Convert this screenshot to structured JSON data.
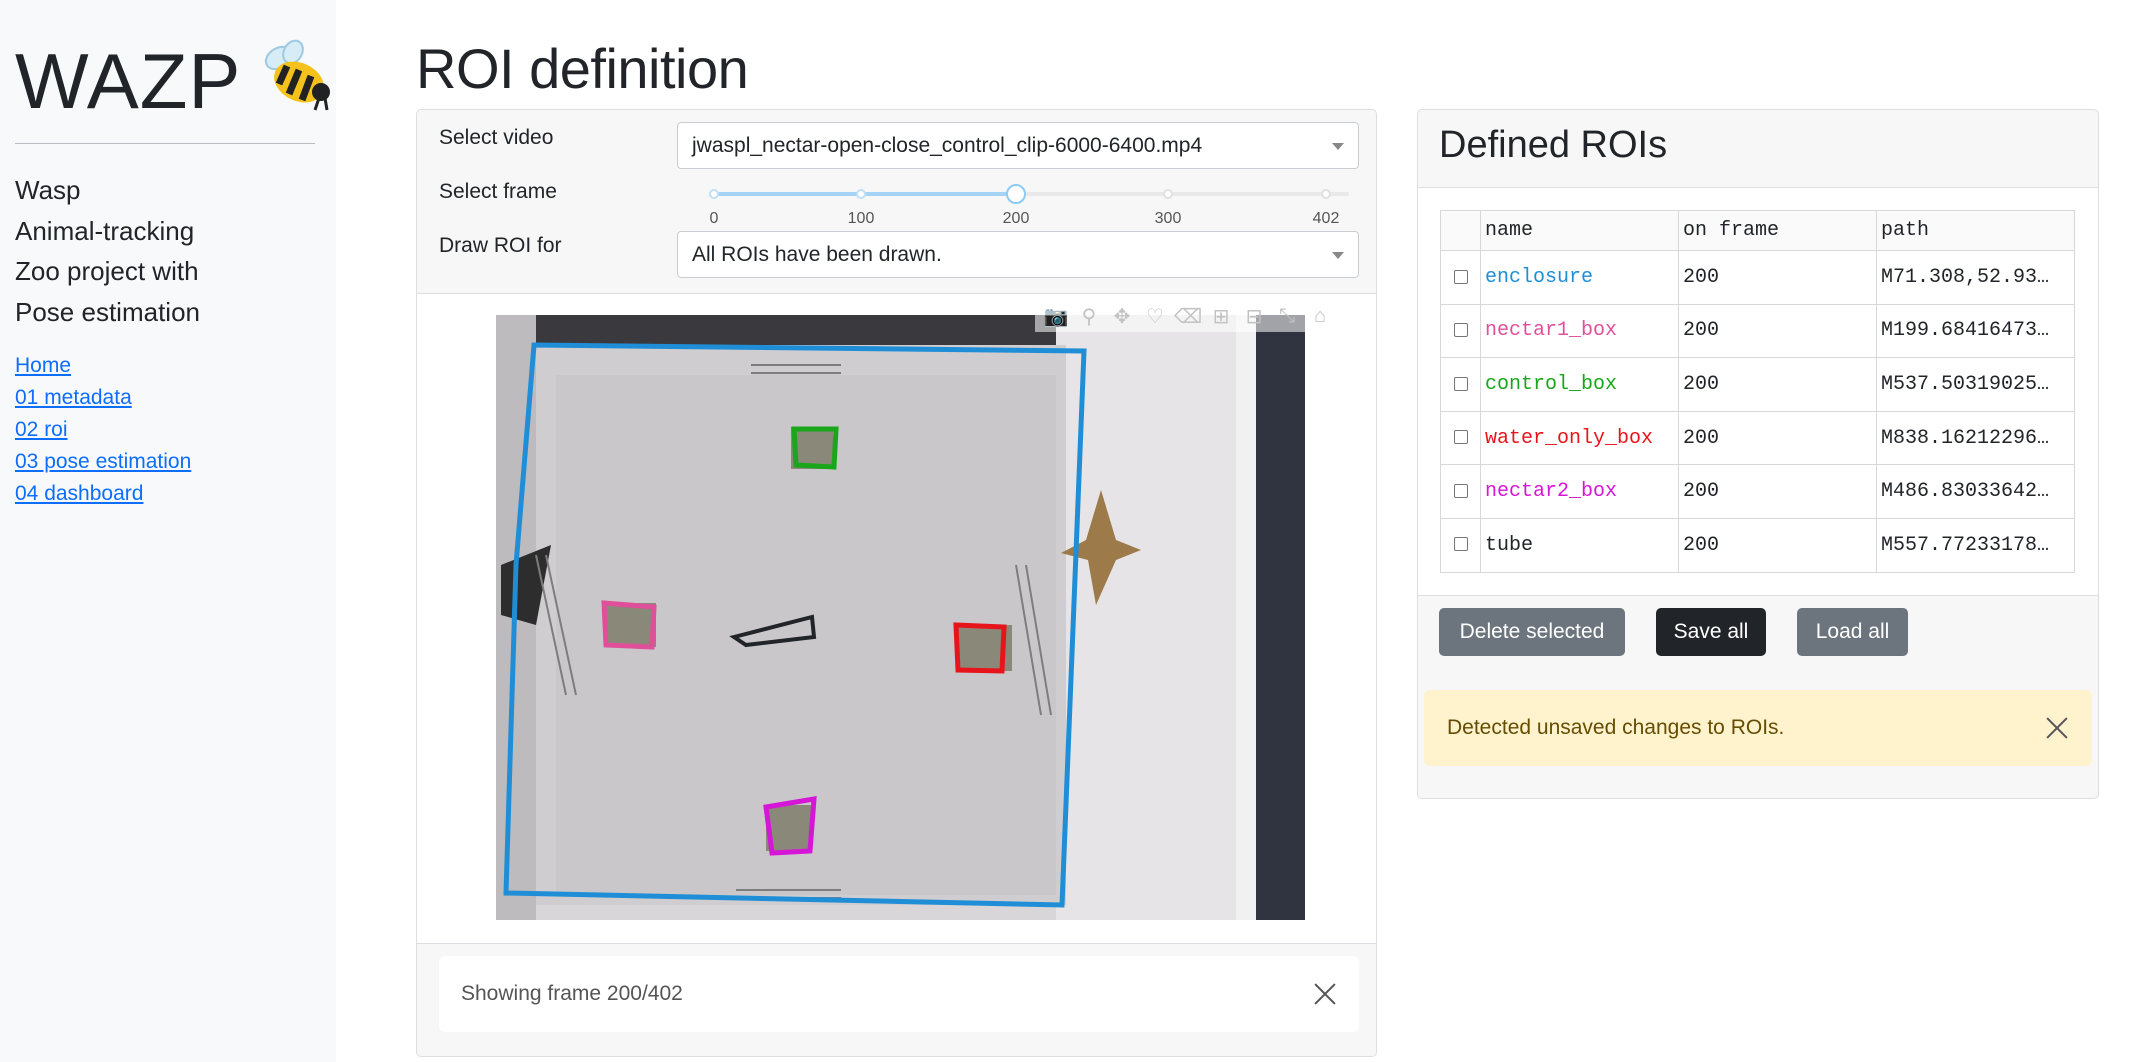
{
  "sidebar": {
    "brand": "WAZP",
    "brand_emoji": "🐝",
    "tagline": [
      "Wasp",
      "Animal-tracking",
      "Zoo project with",
      "Pose estimation"
    ],
    "nav": [
      "Home",
      "01 metadata",
      "02 roi",
      "03 pose estimation",
      "04 dashboard"
    ]
  },
  "page_title": "ROI definition",
  "controls": {
    "select_video_label": "Select video",
    "select_video_value": "jwaspl_nectar-open-close_control_clip-6000-6400.mp4",
    "select_frame_label": "Select frame",
    "slider": {
      "value": 200,
      "min": 0,
      "max": 402,
      "marks": [
        "0",
        "100",
        "200",
        "300",
        "402"
      ]
    },
    "draw_roi_label": "Draw ROI for",
    "draw_roi_value": "All ROIs have been drawn."
  },
  "modebar_icons": [
    "camera-icon",
    "zoom-icon",
    "pan-icon",
    "draw-path-icon",
    "erase-shape-icon",
    "zoom-in-icon",
    "zoom-out-icon",
    "autoscale-icon",
    "reset-axes-icon"
  ],
  "status_message": "Showing frame 200/402",
  "rois_panel": {
    "title": "Defined ROIs",
    "columns": [
      "name",
      "on frame",
      "path"
    ],
    "rows": [
      {
        "name": "enclosure",
        "frame": "200",
        "path": "M71.308,52.93…",
        "color": "#1f8ed6"
      },
      {
        "name": "nectar1_box",
        "frame": "200",
        "path": "M199.68416473…",
        "color": "#e0509a"
      },
      {
        "name": "control_box",
        "frame": "200",
        "path": "M537.50319025…",
        "color": "#1aa61a"
      },
      {
        "name": "water_only_box",
        "frame": "200",
        "path": "M838.16212296…",
        "color": "#e8141b"
      },
      {
        "name": "nectar2_box",
        "frame": "200",
        "path": "M486.83033642…",
        "color": "#d616d6"
      },
      {
        "name": "tube",
        "frame": "200",
        "path": "M557.77233178…",
        "color": "#212529"
      }
    ],
    "buttons": {
      "delete": "Delete selected",
      "save": "Save all",
      "load": "Load all"
    },
    "warning": "Detected unsaved changes to ROIs."
  }
}
